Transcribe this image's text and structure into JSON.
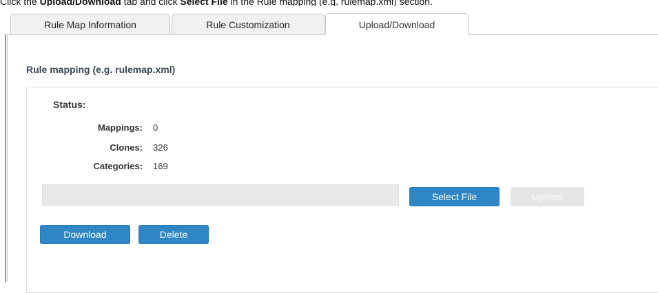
{
  "instruction": {
    "part1": "Click the ",
    "bold1": "Upload/Download",
    "part2": " tab and click ",
    "bold2": "Select File",
    "part3": " in the Rule mapping (e.g. rulemap.xml) section."
  },
  "tabs": [
    {
      "label": "Rule Map Information",
      "active": false
    },
    {
      "label": "Rule Customization",
      "active": false
    },
    {
      "label": "Upload/Download",
      "active": true
    }
  ],
  "section": {
    "title": "Rule mapping (e.g. rulemap.xml)",
    "status_label": "Status:",
    "stats": [
      {
        "label": "Mappings:",
        "value": "0"
      },
      {
        "label": "Clones:",
        "value": "326"
      },
      {
        "label": "Categories:",
        "value": "169"
      }
    ],
    "file_input_value": "",
    "buttons": {
      "select_file": "Select File",
      "upload": "Upload",
      "download": "Download",
      "delete": "Delete"
    }
  },
  "colors": {
    "primary_button": "#2f86c6",
    "disabled_button": "#e5e5e5",
    "section_title": "#3a4554"
  }
}
